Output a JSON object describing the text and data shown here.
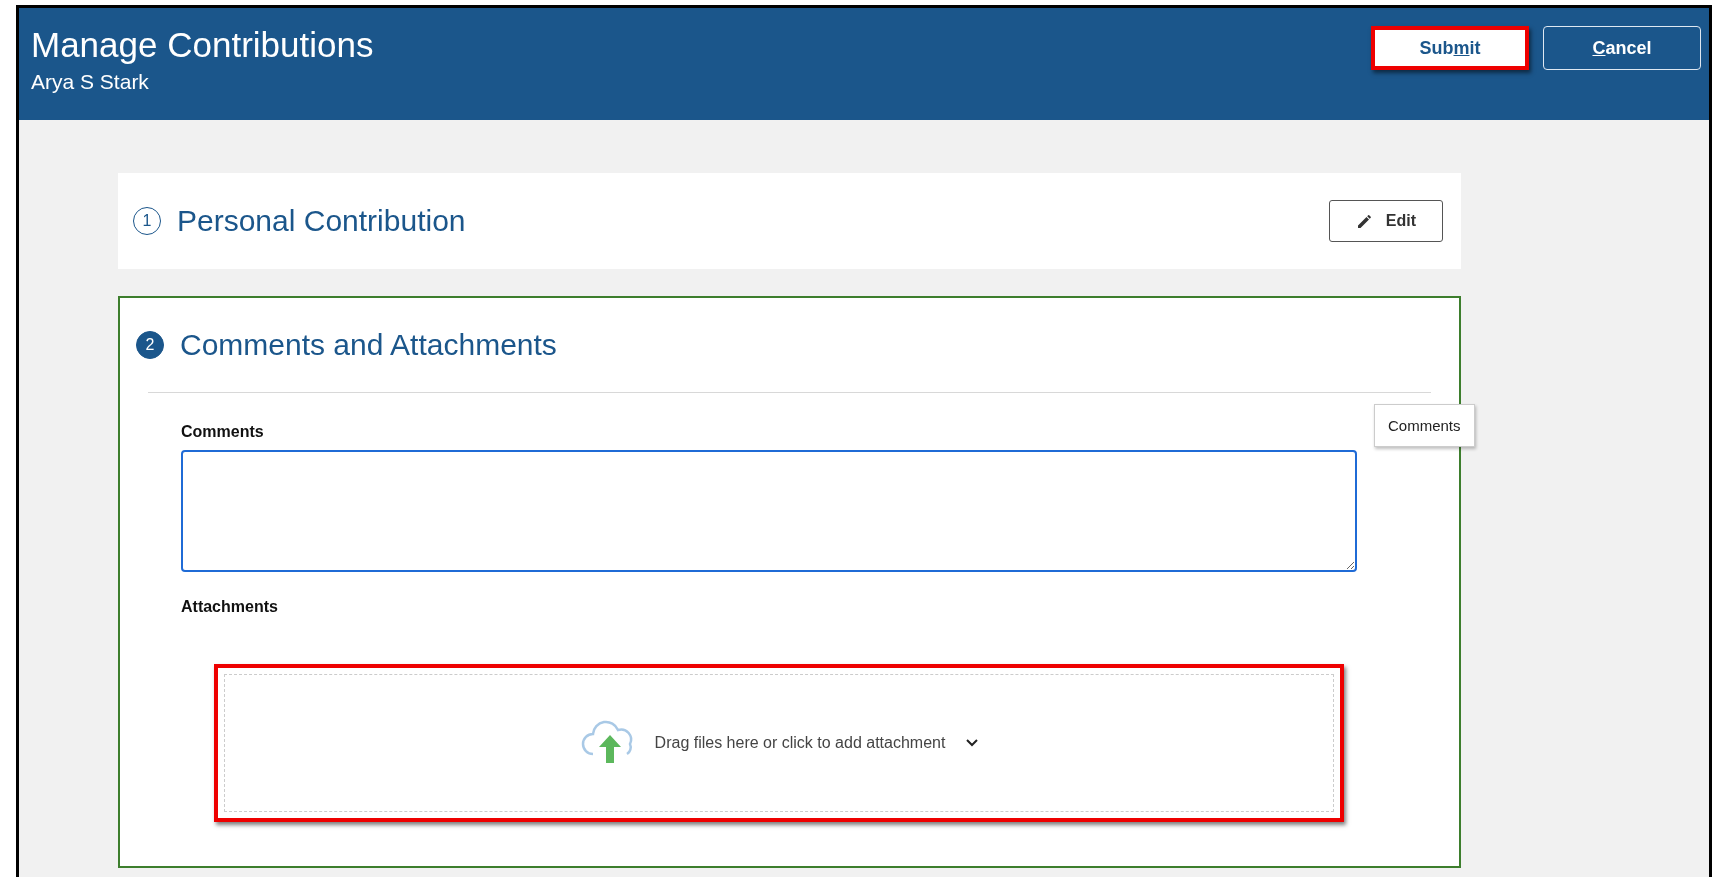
{
  "header": {
    "title": "Manage Contributions",
    "subtitle": "Arya S Stark"
  },
  "header_buttons": [
    {
      "kind": "primary",
      "label_parts": [
        {
          "text": "Sub",
          "underlined": false
        },
        {
          "text": "m",
          "underlined": true
        },
        {
          "text": "it",
          "underlined": false
        }
      ],
      "highlighted": true
    },
    {
      "kind": "secondary",
      "label_parts": [
        {
          "text": "C",
          "underlined": true
        },
        {
          "text": "ancel",
          "underlined": false
        }
      ],
      "highlighted": false
    }
  ],
  "sections": [
    {
      "kind": "collapsed",
      "number": "1",
      "title": "Personal Contribution",
      "current": false,
      "edit_button": "Edit"
    },
    {
      "kind": "expanded",
      "number": "2",
      "title": "Comments and Attachments",
      "current": true,
      "comments": {
        "label": "Comments",
        "focused": true,
        "tooltip": "Comments"
      },
      "attachments": {
        "label": "Attachments",
        "dropzone": "Drag files here or click to add attachment",
        "highlighted": true
      }
    }
  ]
}
